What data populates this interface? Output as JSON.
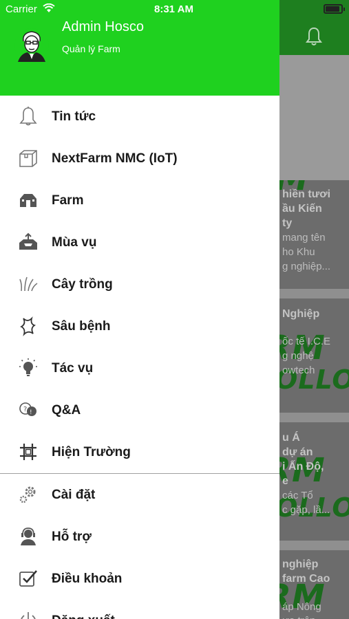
{
  "status_bar": {
    "carrier": "Carrier",
    "time": "8:31 AM"
  },
  "drawer": {
    "user_name": "Admin Hosco",
    "user_role": "Quản lý Farm",
    "menu_items": [
      {
        "label": "Tin tức",
        "icon": "bell-icon"
      },
      {
        "label": "NextFarm NMC (IoT)",
        "icon": "box-icon"
      },
      {
        "label": "Farm",
        "icon": "barn-icon"
      },
      {
        "label": "Mùa vụ",
        "icon": "tray-upload-icon"
      },
      {
        "label": "Cây trồng",
        "icon": "grass-icon"
      },
      {
        "label": "Sâu bệnh",
        "icon": "bug-icon"
      },
      {
        "label": "Tác vụ",
        "icon": "lightbulb-icon"
      },
      {
        "label": "Q&A",
        "icon": "chat-bubbles-icon"
      },
      {
        "label": "Hiện Trường",
        "icon": "grid-hash-icon"
      },
      {
        "label": "Cài đặt",
        "icon": "gears-icon"
      },
      {
        "label": "Hỗ trợ",
        "icon": "headset-icon"
      },
      {
        "label": "Điều khoản",
        "icon": "checkbox-icon"
      },
      {
        "label": "Đăng xuất",
        "icon": "power-icon"
      }
    ]
  },
  "background": {
    "cards": [
      {
        "lines": [
          "hiền tươi",
          "ầu Kiến",
          "ty",
          "mang tên",
          "ho Khu",
          "g nghiệp..."
        ],
        "watermark": "M"
      },
      {
        "lines": [
          "Nghiệp",
          "ốc tế I.C.E",
          "g nghệ",
          "owtech"
        ],
        "watermark": "RM",
        "watermark2": "OLLO"
      },
      {
        "lines": [
          "u Á",
          "dự án",
          "i Ấn Độ,",
          "e",
          "các Tổ",
          "c gặp, lầ..."
        ],
        "watermark": "RM",
        "watermark2": "OLLO"
      },
      {
        "lines": [
          "nghiệp",
          "farm Cao",
          "áp Nông",
          "ựa trên"
        ],
        "watermark": "RM"
      }
    ]
  },
  "colors": {
    "drawer_header": "#1fd11f",
    "app_header_dim": "#1e7f1f",
    "overlay": "#858585"
  }
}
